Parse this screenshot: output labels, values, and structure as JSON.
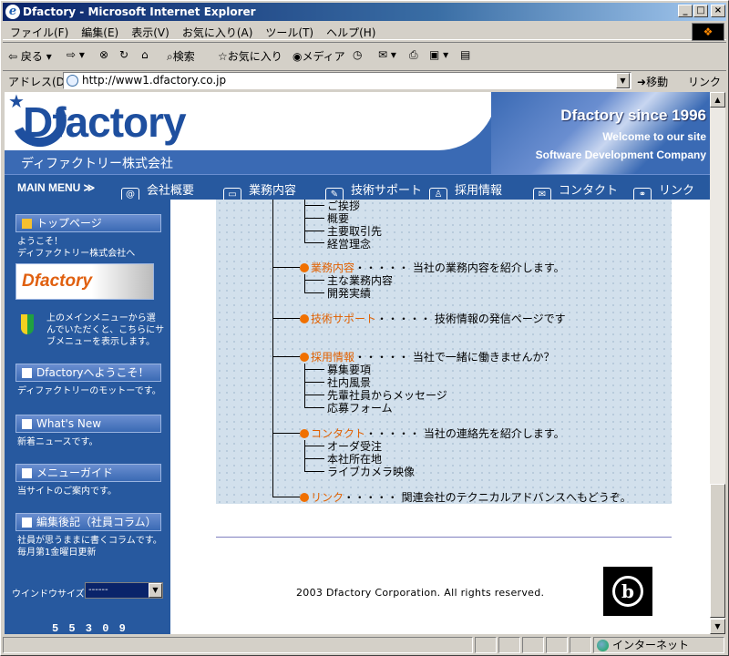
{
  "window": {
    "title": "Dfactory - Microsoft Internet Explorer",
    "min": "_",
    "max": "□",
    "close": "×"
  },
  "menu": [
    "ファイル(F)",
    "編集(E)",
    "表示(V)",
    "お気に入り(A)",
    "ツール(T)",
    "ヘルプ(H)"
  ],
  "toolbar": {
    "back": "戻る",
    "search": "検索",
    "favorites": "お気に入り",
    "media": "メディア"
  },
  "address": {
    "label": "アドレス(D)",
    "url": "http://www1.dfactory.co.jp",
    "go": "移動",
    "links": "リンク"
  },
  "header": {
    "logo": "Dfactory",
    "company_jp": "ディファクトリー株式会社",
    "since": "Dfactory since 1996",
    "welcome": "Welcome to our site",
    "tagline": "Software Development Company"
  },
  "main_menu": {
    "label": "MAIN MENU ≫",
    "items": [
      "会社概要",
      "業務内容",
      "技術サポート",
      "採用情報",
      "コンタクト",
      "リンク"
    ]
  },
  "sidebar": {
    "top_button": "トップページ",
    "welcome_text": [
      "ようこそ！",
      "ディファクトリー株式会社へ"
    ],
    "banner": "Dfactory",
    "help_text": [
      "上のメインメニューから選",
      "んでいただくと、こちらにサ",
      "ブメニューを表示します。"
    ],
    "buttons": [
      {
        "label": "Dfactoryへようこそ！",
        "desc": [
          "ディファクトリーのモットーです。"
        ]
      },
      {
        "label": "What's New",
        "desc": [
          "新着ニュースです。"
        ]
      },
      {
        "label": "メニューガイド",
        "desc": [
          "当サイトのご案内です。"
        ]
      },
      {
        "label": "編集後記（社員コラム）",
        "desc": [
          "社員が思うままに書くコラムです。",
          "毎月第1金曜日更新"
        ]
      }
    ],
    "window_size_label": "ウインドウサイズ",
    "window_size_value": "------",
    "counter": "5 5 3 0 9"
  },
  "sitemap": {
    "top_subs": [
      "ご挨拶",
      "概要",
      "主要取引先",
      "経営理念"
    ],
    "sections": [
      {
        "name": "業務内容",
        "desc": "・・・・・ 当社の業務内容を紹介します。",
        "subs": [
          "主な業務内容",
          "開発実績"
        ]
      },
      {
        "name": "技術サポート",
        "desc": "・・・・・ 技術情報の発信ページです",
        "subs": []
      },
      {
        "name": "採用情報",
        "desc": "・・・・・ 当社で一緒に働きませんか？",
        "subs": [
          "募集要項",
          "社内風景",
          "先輩社員からメッセージ",
          "応募フォーム"
        ]
      },
      {
        "name": "コンタクト",
        "desc": "・・・・・ 当社の連絡先を紹介します。",
        "subs": [
          "オーダ受注",
          "本社所在地",
          "ライブカメラ映像"
        ]
      },
      {
        "name": "リンク",
        "desc": "・・・・・ 関連会社のテクニカルアドバンスへもどうぞ。",
        "subs": []
      }
    ]
  },
  "footer": {
    "copyright": "2003 Dfactory Corporation. All rights reserved.",
    "logo_glyph": "b"
  },
  "status": {
    "zone": "インターネット"
  }
}
